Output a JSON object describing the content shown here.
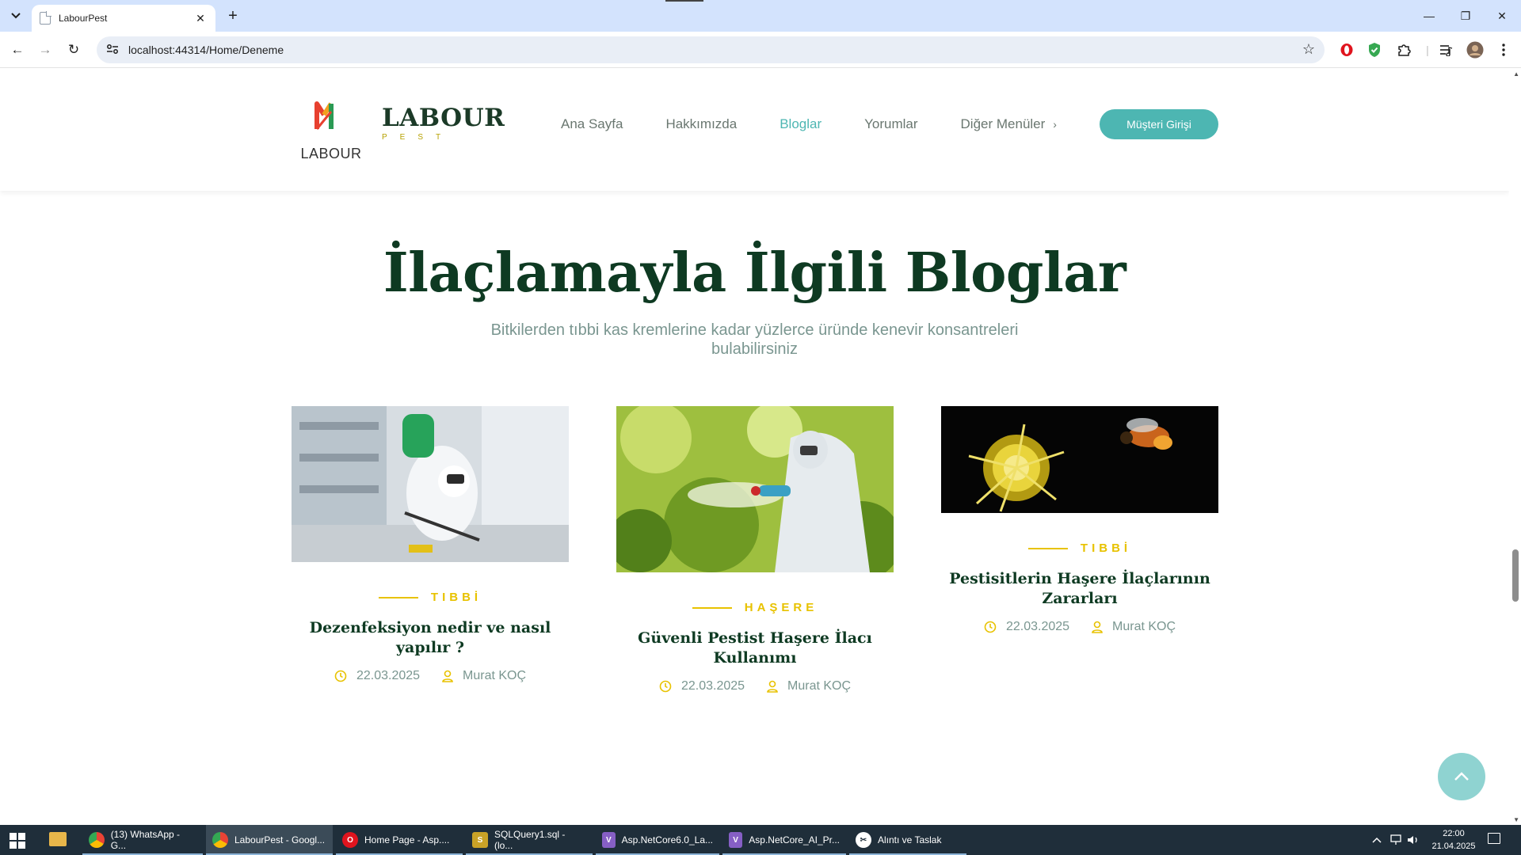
{
  "browser": {
    "tab_title": "LabourPest",
    "tab_close": "✕",
    "new_tab": "+",
    "url": "localhost:44314/Home/Deneme",
    "window_controls": {
      "minimize": "—",
      "maximize": "❐",
      "close": "✕"
    },
    "nav": {
      "back": "←",
      "forward": "→",
      "reload": "↻"
    },
    "icons": {
      "tab_list": "chevron-down-icon",
      "site_info": "tune-icon",
      "bookmark": "star-icon",
      "opera": "opera-icon",
      "shield": "shield-icon",
      "extensions": "puzzle-icon",
      "media": "media-control-icon",
      "profile": "avatar-icon",
      "menu": "kebab-menu-icon"
    }
  },
  "site": {
    "brand_caption": "LABOUR",
    "brand_name": "LABOUR",
    "brand_sub": "PEST",
    "nav": [
      {
        "label": "Ana Sayfa",
        "active": false
      },
      {
        "label": "Hakkımızda",
        "active": false
      },
      {
        "label": "Bloglar",
        "active": true
      },
      {
        "label": "Yorumlar",
        "active": false
      }
    ],
    "nav_dropdown": "Diğer Menüler",
    "login_label": "Müşteri Girişi",
    "colors": {
      "accent": "#4db6b2",
      "gold": "#e8c200",
      "heading": "#0e3a22",
      "muted": "#7a9690"
    }
  },
  "section": {
    "title": "İlaçlamayla İlgili Bloglar",
    "subtitle": "Bitkilerden tıbbi kas kremlerine kadar yüzlerce üründe kenevir konsantreleri bulabilirsiniz"
  },
  "posts": [
    {
      "category": "TIBBİ",
      "title": "Dezenfeksiyon nedir ve nasıl yapılır ?",
      "date": "22.03.2025",
      "author": "Murat KOÇ"
    },
    {
      "category": "HAŞERE",
      "title": "Güvenli Pestist Haşere İlacı Kullanımı",
      "date": "22.03.2025",
      "author": "Murat KOÇ"
    },
    {
      "category": "TIBBİ",
      "title": "Pestisitlerin Haşere İlaçlarının Zararları",
      "date": "22.03.2025",
      "author": "Murat KOÇ"
    }
  ],
  "taskbar": {
    "items": [
      {
        "label": "(13) WhatsApp - G...",
        "icon": "chrome-icon"
      },
      {
        "label": "LabourPest - Googl...",
        "icon": "chrome-icon"
      },
      {
        "label": "Home Page - Asp....",
        "icon": "opera-icon"
      },
      {
        "label": "SQLQuery1.sql - (lo...",
        "icon": "ssms-icon"
      },
      {
        "label": "Asp.NetCore6.0_La...",
        "icon": "visual-studio-icon"
      },
      {
        "label": "Asp.NetCore_AI_Pr...",
        "icon": "visual-studio-icon"
      },
      {
        "label": "Alıntı ve Taslak",
        "icon": "snipping-tool-icon"
      }
    ],
    "time": "22:00",
    "date": "21.04.2025"
  }
}
